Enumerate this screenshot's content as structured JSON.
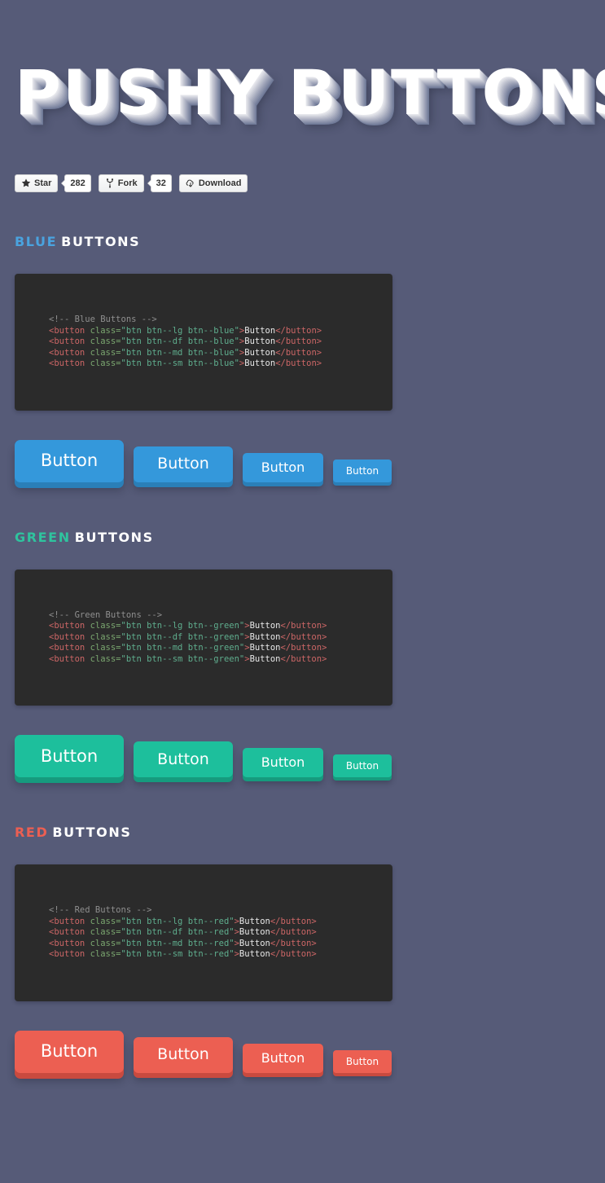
{
  "page": {
    "background_color": "#565b78",
    "title": "PUSHY BUTTONS"
  },
  "github": {
    "star_label": "Star",
    "star_count": "282",
    "fork_label": "Fork",
    "fork_count": "32",
    "download_label": "Download",
    "star_icon": "star-icon",
    "fork_icon": "fork-icon",
    "download_icon": "cloud-download-icon"
  },
  "sections": [
    {
      "id": "blue",
      "accent_word": "BLUE",
      "plain_word": "BUTTONS",
      "accent_color": "#4aa3df",
      "code": {
        "comment": "<!-- Blue Buttons -->",
        "lines": [
          {
            "open": "<button ",
            "attr": "class=",
            "value": "\"btn btn--lg btn--blue\"",
            "gt": ">",
            "text": "Button",
            "close": "</button>"
          },
          {
            "open": "<button ",
            "attr": "class=",
            "value": "\"btn btn--df btn--blue\"",
            "gt": ">",
            "text": "Button",
            "close": "</button>"
          },
          {
            "open": "<button ",
            "attr": "class=",
            "value": "\"btn btn--md btn--blue\"",
            "gt": ">",
            "text": "Button",
            "close": "</button>"
          },
          {
            "open": "<button ",
            "attr": "class=",
            "value": "\"btn btn--sm btn--blue\"",
            "gt": ">",
            "text": "Button",
            "close": "</button>"
          }
        ]
      },
      "buttons": [
        {
          "size": "lg",
          "label": "Button"
        },
        {
          "size": "df",
          "label": "Button"
        },
        {
          "size": "md",
          "label": "Button"
        },
        {
          "size": "sm",
          "label": "Button"
        }
      ],
      "button_color": "#3498db",
      "button_shadow_color": "#2a7fb8"
    },
    {
      "id": "green",
      "accent_word": "GREEN",
      "plain_word": "BUTTONS",
      "accent_color": "#2fc39e",
      "code": {
        "comment": "<!-- Green Buttons -->",
        "lines": [
          {
            "open": "<button ",
            "attr": "class=",
            "value": "\"btn btn--lg btn--green\"",
            "gt": ">",
            "text": "Button",
            "close": "</button>"
          },
          {
            "open": "<button ",
            "attr": "class=",
            "value": "\"btn btn--df btn--green\"",
            "gt": ">",
            "text": "Button",
            "close": "</button>"
          },
          {
            "open": "<button ",
            "attr": "class=",
            "value": "\"btn btn--md btn--green\"",
            "gt": ">",
            "text": "Button",
            "close": "</button>"
          },
          {
            "open": "<button ",
            "attr": "class=",
            "value": "\"btn btn--sm btn--green\"",
            "gt": ">",
            "text": "Button",
            "close": "</button>"
          }
        ]
      },
      "buttons": [
        {
          "size": "lg",
          "label": "Button"
        },
        {
          "size": "df",
          "label": "Button"
        },
        {
          "size": "md",
          "label": "Button"
        },
        {
          "size": "sm",
          "label": "Button"
        }
      ],
      "button_color": "#1dbf9c",
      "button_shadow_color": "#169b7e"
    },
    {
      "id": "red",
      "accent_word": "RED",
      "plain_word": "BUTTONS",
      "accent_color": "#ec5f52",
      "code": {
        "comment": "<!-- Red Buttons -->",
        "lines": [
          {
            "open": "<button ",
            "attr": "class=",
            "value": "\"btn btn--lg btn--red\"",
            "gt": ">",
            "text": "Button",
            "close": "</button>"
          },
          {
            "open": "<button ",
            "attr": "class=",
            "value": "\"btn btn--df btn--red\"",
            "gt": ">",
            "text": "Button",
            "close": "</button>"
          },
          {
            "open": "<button ",
            "attr": "class=",
            "value": "\"btn btn--md btn--red\"",
            "gt": ">",
            "text": "Button",
            "close": "</button>"
          },
          {
            "open": "<button ",
            "attr": "class=",
            "value": "\"btn btn--sm btn--red\"",
            "gt": ">",
            "text": "Button",
            "close": "</button>"
          }
        ]
      },
      "buttons": [
        {
          "size": "lg",
          "label": "Button"
        },
        {
          "size": "df",
          "label": "Button"
        },
        {
          "size": "md",
          "label": "Button"
        },
        {
          "size": "sm",
          "label": "Button"
        }
      ],
      "button_color": "#ec5f52",
      "button_shadow_color": "#c94a3f"
    }
  ]
}
